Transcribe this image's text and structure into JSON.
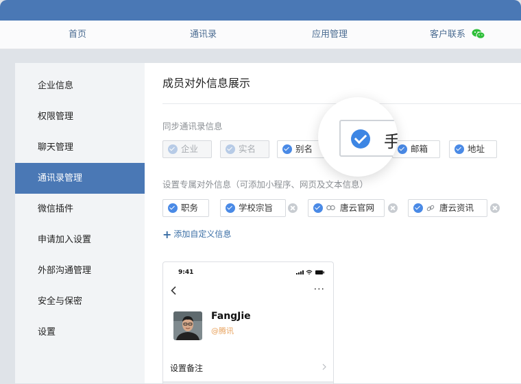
{
  "nav": {
    "home": "首页",
    "contacts": "通讯录",
    "apps": "应用管理",
    "service": "客户联系",
    "service_icon": "wechat-icon"
  },
  "sidebar": {
    "items": [
      {
        "label": "企业信息"
      },
      {
        "label": "权限管理"
      },
      {
        "label": "聊天管理"
      },
      {
        "label": "通讯录管理",
        "active": true
      },
      {
        "label": "微信插件"
      },
      {
        "label": "申请加入设置"
      },
      {
        "label": "外部沟通管理"
      },
      {
        "label": "安全与保密"
      },
      {
        "label": "设置"
      }
    ]
  },
  "main": {
    "title": "成员对外信息展示",
    "sync_label": "同步通讯录信息",
    "sync_tags": [
      {
        "label": "企业",
        "disabled": true
      },
      {
        "label": "实名",
        "disabled": true
      },
      {
        "label": "别名",
        "checked": true
      },
      {
        "label": "邮箱",
        "checked": true
      },
      {
        "label": "地址",
        "checked": true
      }
    ],
    "custom_label": "设置专属对外信息（可添加小程序、网页及文本信息）",
    "custom_tags": [
      {
        "label": "职务",
        "checked": true
      },
      {
        "label": "学校宗旨",
        "checked": true
      },
      {
        "label": "唐云官网",
        "checked": true,
        "icon": "link-icon"
      },
      {
        "label": "唐云资讯",
        "checked": true,
        "icon": "link-icon"
      }
    ],
    "add_label": "添加自定义信息"
  },
  "magnifier": {
    "text": "手"
  },
  "phone": {
    "time": "9:41",
    "more": "···",
    "name": "FangJie",
    "org": "@腾讯",
    "remark": "设置备注"
  },
  "colors": {
    "brand": "#4a78b5",
    "check": "#4a8ae6",
    "link": "#3a6ea5",
    "org": "#e8a25d"
  }
}
